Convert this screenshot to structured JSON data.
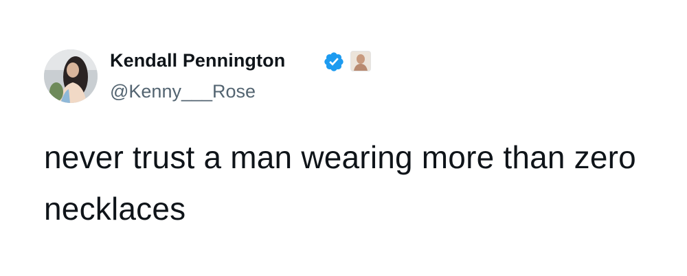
{
  "author": {
    "name": "Kendall Pennington",
    "handle": "@Kenny___Rose",
    "verified": true,
    "verified_color": "#1d9bf0",
    "avatar_icon": "profile-photo",
    "affiliate_icon": "affiliate-badge"
  },
  "tweet": {
    "text": "never trust a man wearing more than zero necklaces"
  },
  "colors": {
    "text_primary": "#0f1419",
    "text_secondary": "#536471",
    "background": "#ffffff"
  }
}
